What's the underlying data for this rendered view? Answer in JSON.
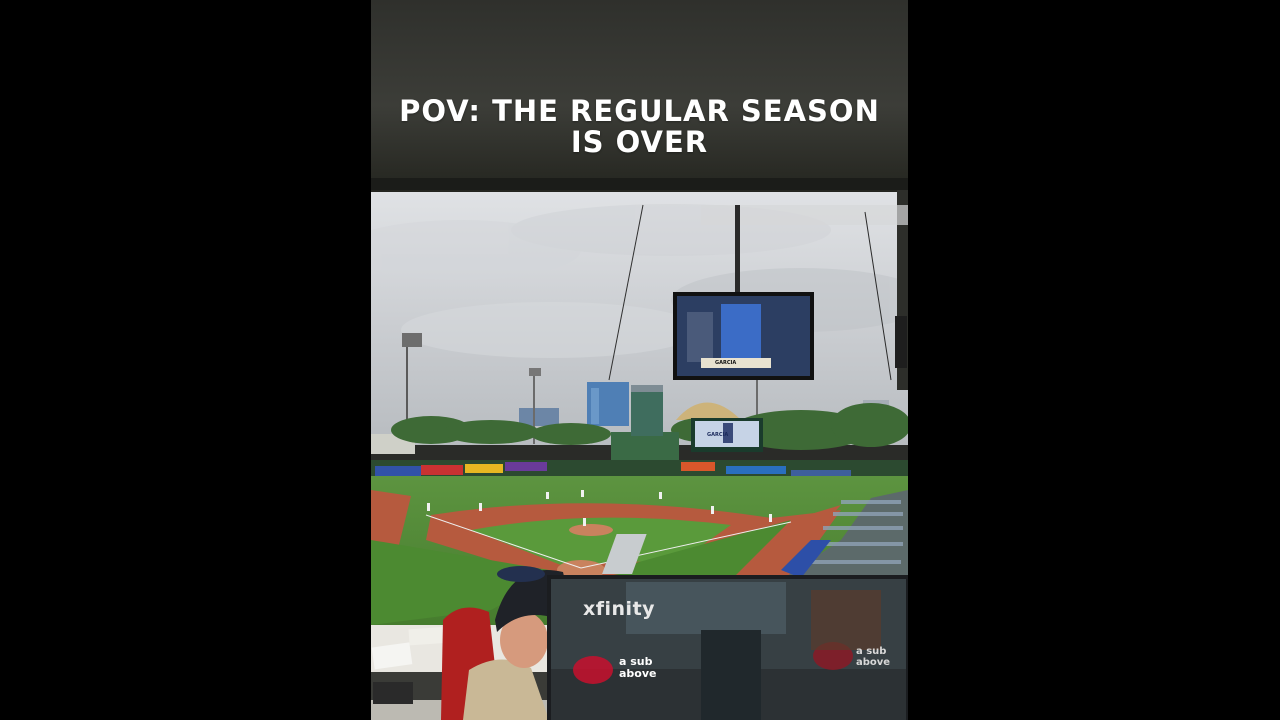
{
  "caption": {
    "line1": "POV: THE REGULAR SEASON",
    "line2": "IS OVER"
  },
  "screens": {
    "laptop_brand": "xfinity",
    "laptop_sub_text": "a sub above",
    "laptop_sub_text_right": "a sub above",
    "scoreboard_name": "GARCIA",
    "tv_name": "GARCIA"
  },
  "colors": {
    "letterbox": "#000000",
    "sky": "#c4c7cc",
    "grass": "#4f8a35",
    "infield_dirt": "#b65a3e",
    "caption_text": "#ffffff"
  }
}
